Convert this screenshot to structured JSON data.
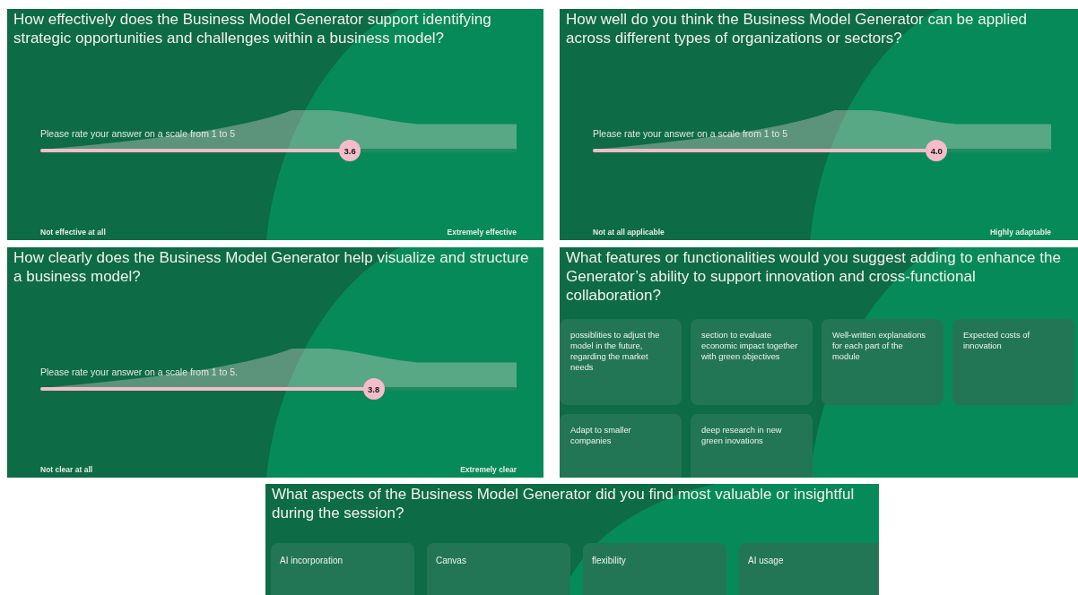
{
  "slides": [
    {
      "kind": "scale",
      "question": "How effectively does the Business Model Generator support identifying strategic opportunities and challenges within a business model?",
      "prompt": "Please rate your answer on a scale from 1 to 5",
      "value": "3.6",
      "level": 0.65,
      "min_label": "Not effective at all",
      "max_label": "Extremely effective"
    },
    {
      "kind": "scale",
      "question": "How well do you think the Business Model Generator can be applied across different types of organizations or sectors?",
      "prompt": "Please rate your answer on a scale from 1 to 5",
      "value": "4.0",
      "level": 0.75,
      "min_label": "Not at all applicable",
      "max_label": "Highly adaptable"
    },
    {
      "kind": "scale",
      "question": "How clearly does the Business Model Generator help visualize and structure a business model?",
      "prompt": "Please rate your answer on a scale from 1 to 5.",
      "value": "3.8",
      "level": 0.7,
      "min_label": "Not clear at all",
      "max_label": "Extremely clear"
    },
    {
      "kind": "open",
      "question": "What features or functionalities would you suggest adding to enhance the Generator’s ability to support innovation and cross-functional collaboration?",
      "answers": [
        "possiblities to adjust the model in the future, regarding the market needs",
        "section to evaluate economic impact together with green objectives",
        "Well-written explanations for each part of the module",
        "Expected costs of innovation",
        "Adapt to smaller companies",
        "deep research in new green inovations"
      ]
    },
    {
      "kind": "open",
      "question": "What aspects of the Business Model Generator did you find most valuable or insightful during the session?",
      "answers": [
        "AI incorporation",
        "Canvas",
        "flexibility",
        "AI usage"
      ]
    }
  ]
}
